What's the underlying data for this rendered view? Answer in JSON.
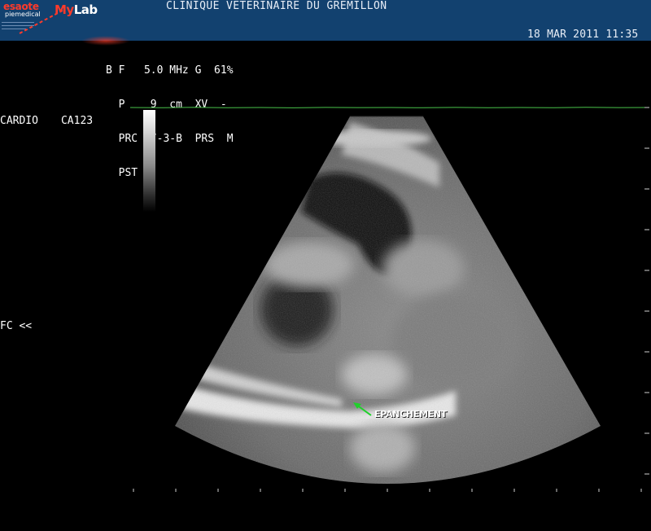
{
  "header": {
    "brand_left": "esaote",
    "brand_sub": "piemedical",
    "brand_right_a": "My",
    "brand_right_b": "Lab",
    "clinic_name": "CLINIQUE VETERINAIRE DU GREMILLON",
    "datetime": "18 MAR 2011 11:35"
  },
  "params": [
    "B F   5.0 MHz G  61%",
    "  P    9  cm  XV  -",
    "  PRC  7-3-B  PRS  M",
    "  PST 2"
  ],
  "left_panel": {
    "mode": "CARDIO",
    "probe": "CA123",
    "fc": "FC <<"
  },
  "annotation": {
    "label": "EPANCHEMENT"
  },
  "colors": {
    "header_bg": "#12416f",
    "accent_red": "#ff3a2a",
    "ecg_green": "#49c24a",
    "arrow_green": "#1fd12a"
  },
  "icons": {
    "annotation_arrow": "arrow-up-left-icon"
  }
}
